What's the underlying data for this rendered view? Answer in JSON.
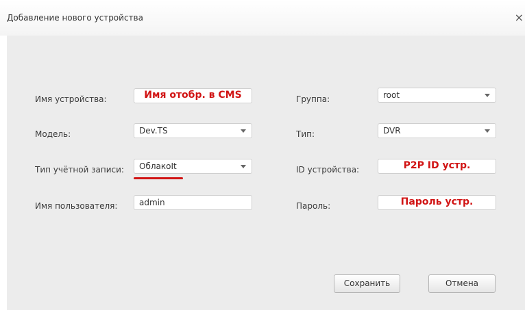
{
  "window": {
    "title": "Добавление нового устройства",
    "close_glyph": "×"
  },
  "form": {
    "device_name": {
      "label": "Имя устройства:",
      "value": "Имя отобр. в CMS"
    },
    "group": {
      "label": "Группа:",
      "value": "root"
    },
    "model": {
      "label": "Модель:",
      "value": "Dev.TS"
    },
    "type": {
      "label": "Тип:",
      "value": "DVR"
    },
    "account_type": {
      "label": "Тип учётной записи:",
      "value": "ОблакоIt"
    },
    "device_id": {
      "label": "ID устройства:",
      "value": "P2P ID устр."
    },
    "username": {
      "label": "Имя пользователя:",
      "value": "admin"
    },
    "password": {
      "label": "Пароль:",
      "value": "Пароль устр."
    }
  },
  "buttons": {
    "save": "Сохранить",
    "cancel": "Отмена"
  },
  "colors": {
    "annotation": "#d11414",
    "content_bg": "#ececec"
  }
}
